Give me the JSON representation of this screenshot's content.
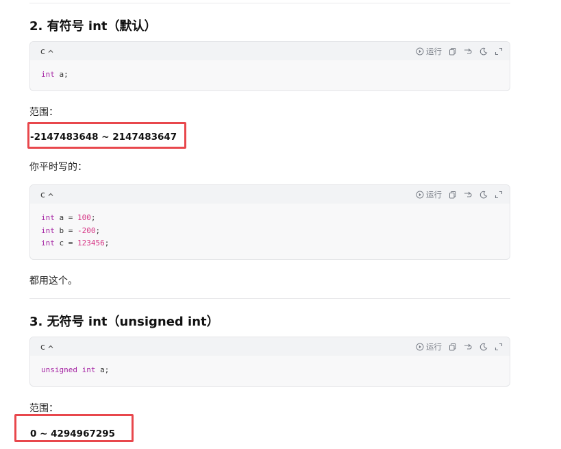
{
  "section2": {
    "heading": "2. 有符号 int（默认）",
    "code1": {
      "lang": "c",
      "run_label": "运行",
      "lines": [
        [
          {
            "t": "int",
            "c": "kw"
          },
          {
            "t": " a;",
            "c": ""
          }
        ]
      ]
    },
    "range_label": "范围：",
    "range_value": "-2147483648 ~ 2147483647",
    "usage_label": "你平时写的：",
    "code2": {
      "lang": "c",
      "run_label": "运行",
      "lines": [
        [
          {
            "t": "int",
            "c": "kw"
          },
          {
            "t": " a = ",
            "c": ""
          },
          {
            "t": "100",
            "c": "num"
          },
          {
            "t": ";",
            "c": ""
          }
        ],
        [
          {
            "t": "int",
            "c": "kw"
          },
          {
            "t": " b = ",
            "c": ""
          },
          {
            "t": "-200",
            "c": "num"
          },
          {
            "t": ";",
            "c": ""
          }
        ],
        [
          {
            "t": "int",
            "c": "kw"
          },
          {
            "t": " c = ",
            "c": ""
          },
          {
            "t": "123456",
            "c": "num"
          },
          {
            "t": ";",
            "c": ""
          }
        ]
      ]
    },
    "note": "都用这个。"
  },
  "section3": {
    "heading": "3. 无符号 int（unsigned int）",
    "code": {
      "lang": "c",
      "run_label": "运行",
      "lines": [
        [
          {
            "t": "unsigned",
            "c": "kw"
          },
          {
            "t": " ",
            "c": ""
          },
          {
            "t": "int",
            "c": "kw"
          },
          {
            "t": " a;",
            "c": ""
          }
        ]
      ]
    },
    "range_label": "范围：",
    "range_value": "0 ~ 4294967295"
  },
  "colors": {
    "highlight": "#e8474c",
    "keyword": "#a626a4",
    "number": "#d63384"
  },
  "icons": [
    "chevron-up-icon",
    "play-circle-icon",
    "copy-icon",
    "wrap-icon",
    "theme-icon",
    "fullscreen-icon"
  ]
}
